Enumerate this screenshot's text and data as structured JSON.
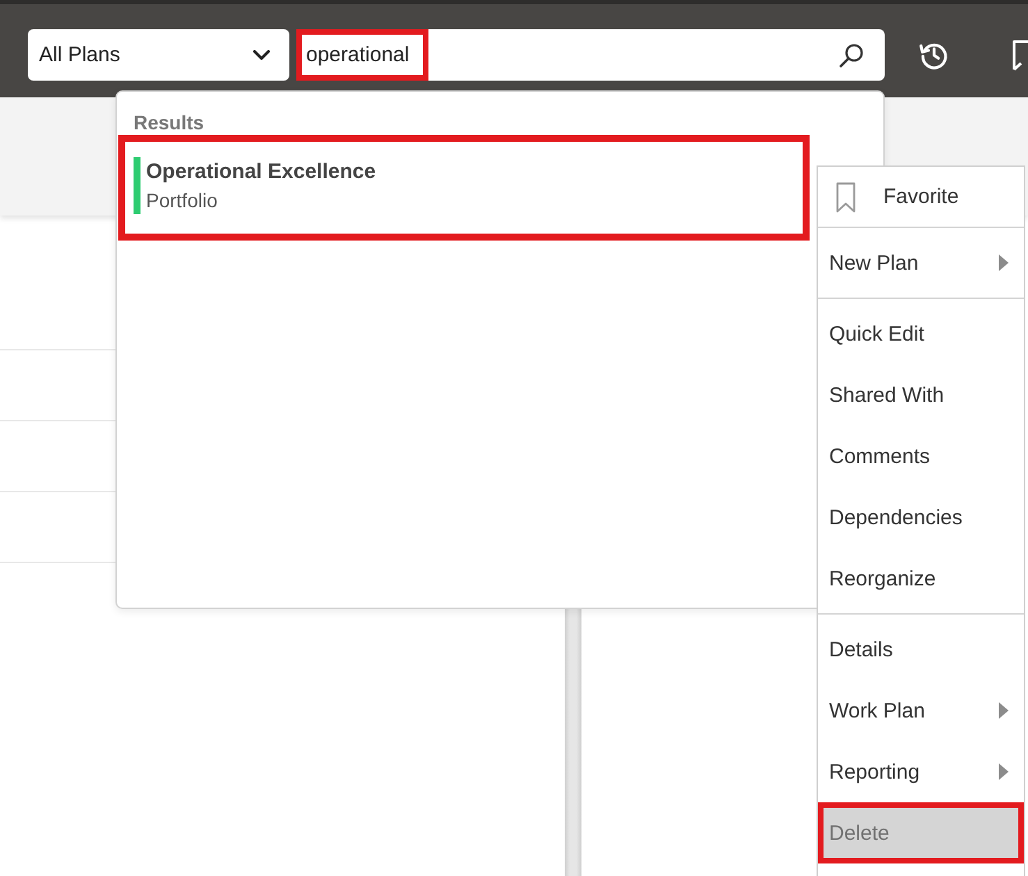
{
  "top_bar": {
    "plan_filter": {
      "value": "All Plans"
    },
    "search": {
      "value": "operational",
      "annotated": true
    }
  },
  "results": {
    "heading": "Results",
    "items": [
      {
        "title": "Operational Excellence",
        "type": "Portfolio",
        "color": "#2ecc71",
        "annotated": true
      }
    ]
  },
  "context_menu": {
    "groups": [
      {
        "items": [
          {
            "label": "Favorite",
            "kind": "bookmark",
            "submenu": false,
            "selected": false,
            "annotated": false
          }
        ]
      },
      {
        "items": [
          {
            "label": "New Plan",
            "kind": "command",
            "submenu": true,
            "selected": false,
            "annotated": false
          }
        ]
      },
      {
        "items": [
          {
            "label": "Quick Edit",
            "kind": "command",
            "submenu": false,
            "selected": false,
            "annotated": false
          },
          {
            "label": "Shared With",
            "kind": "command",
            "submenu": false,
            "selected": false,
            "annotated": false
          },
          {
            "label": "Comments",
            "kind": "command",
            "submenu": false,
            "selected": false,
            "annotated": false
          },
          {
            "label": "Dependencies",
            "kind": "command",
            "submenu": false,
            "selected": false,
            "annotated": false
          },
          {
            "label": "Reorganize",
            "kind": "command",
            "submenu": false,
            "selected": false,
            "annotated": false
          }
        ]
      },
      {
        "items": [
          {
            "label": "Details",
            "kind": "command",
            "submenu": false,
            "selected": false,
            "annotated": false
          },
          {
            "label": "Work Plan",
            "kind": "command",
            "submenu": true,
            "selected": false,
            "annotated": false
          },
          {
            "label": "Reporting",
            "kind": "command",
            "submenu": true,
            "selected": false,
            "annotated": false
          },
          {
            "label": "Delete",
            "kind": "command",
            "submenu": false,
            "selected": true,
            "annotated": true
          }
        ]
      }
    ]
  }
}
